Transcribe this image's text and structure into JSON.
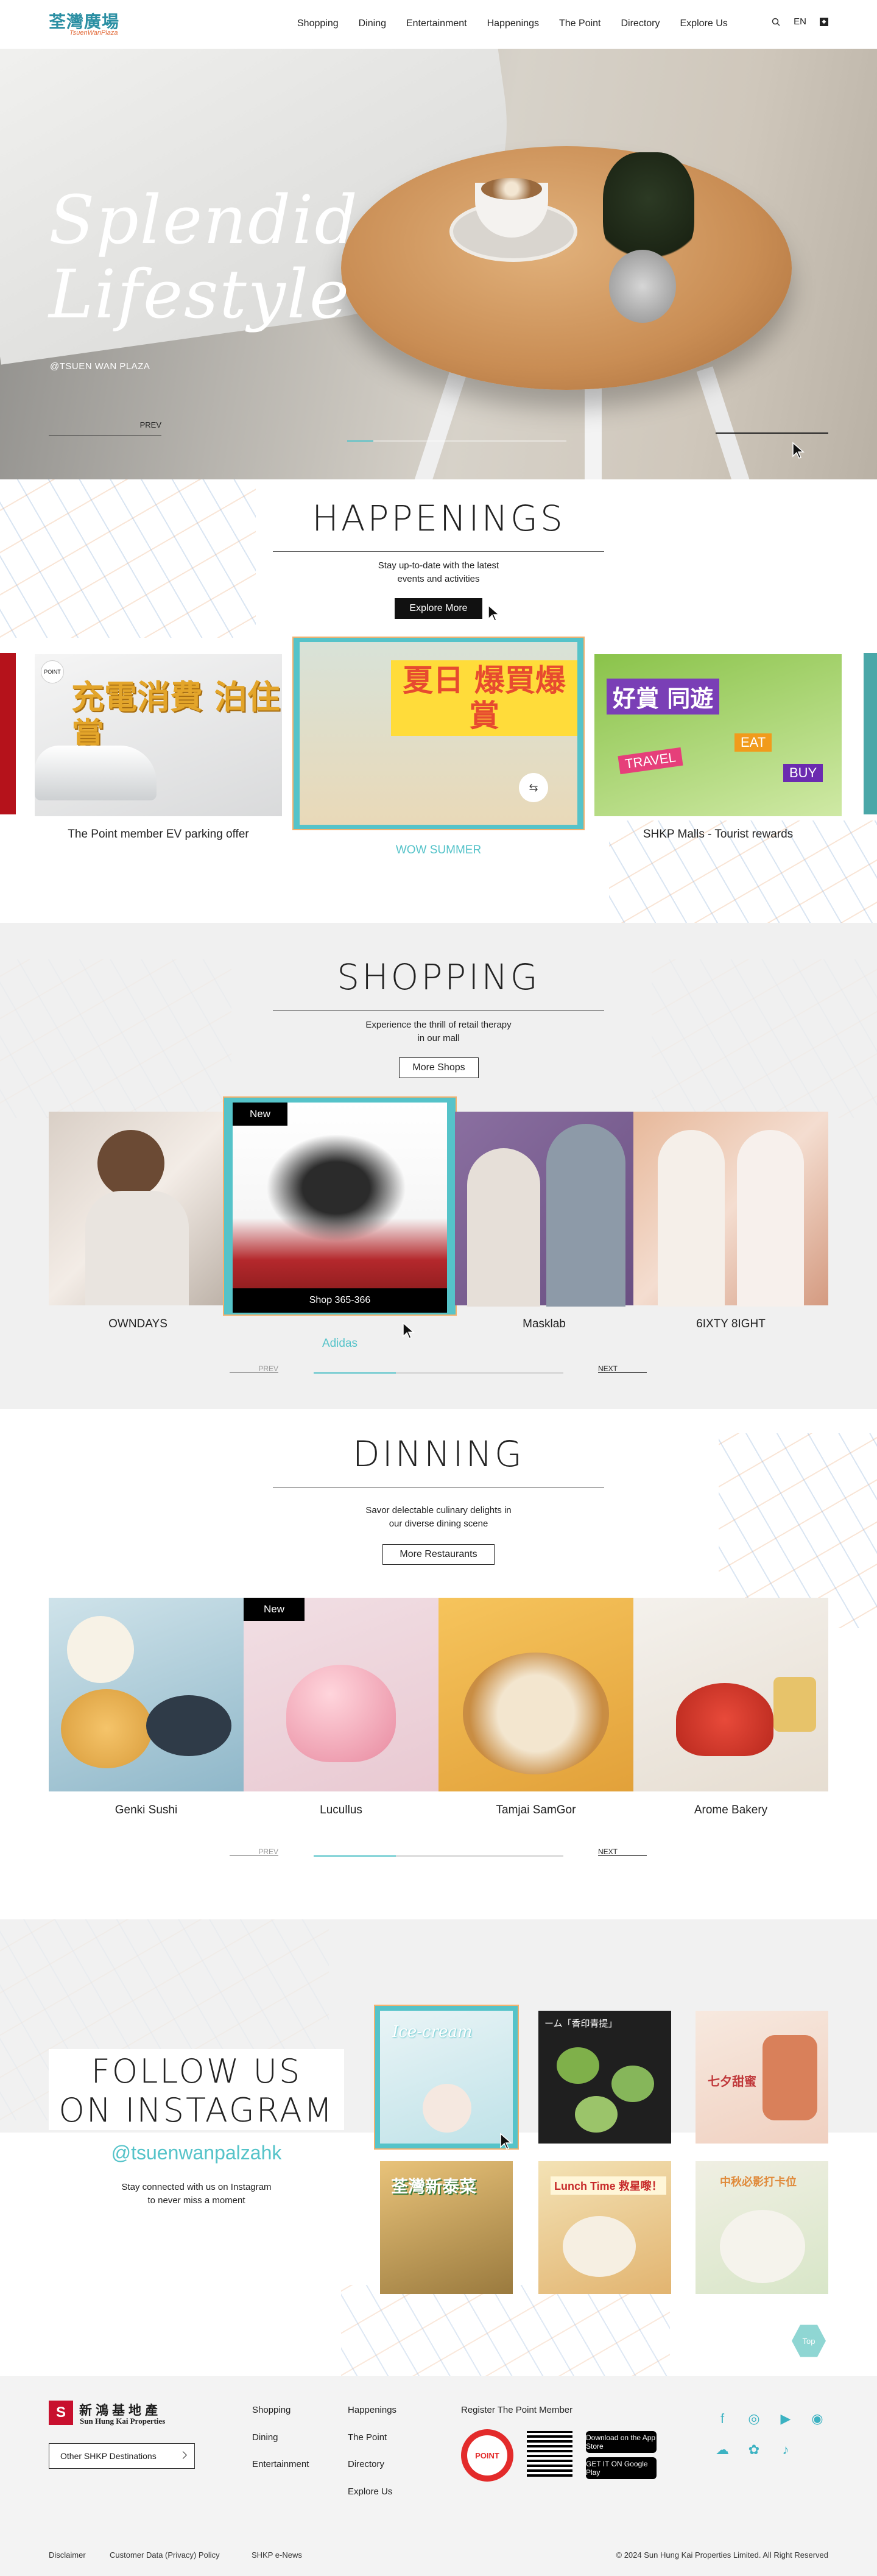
{
  "header": {
    "logo_cn": "荃灣廣場",
    "logo_en": "TsuenWanPlaza",
    "nav": [
      "Shopping",
      "Dining",
      "Entertainment",
      "Happenings",
      "The Point",
      "Directory",
      "Explore Us"
    ],
    "lang": "EN",
    "icons": [
      "search-icon",
      "user-icon"
    ]
  },
  "hero": {
    "title_line1": "Splendid",
    "title_line2": "Lifestyle",
    "subtitle": "@TSUEN WAN PLAZA",
    "prev": "PREV",
    "progress": 0.12
  },
  "happenings": {
    "title": "HAPPENINGS",
    "desc1": "Stay up-to-date with the latest",
    "desc2": "events and activities",
    "button": "Explore More",
    "cards": [
      {
        "caption": "The Point member EV parking offer",
        "art": "充電消費 泊住賞",
        "badge": "POINT"
      },
      {
        "caption": "WOW SUMMER",
        "art": "夏日 爆買爆賞"
      },
      {
        "caption": "SHKP Malls - Tourist rewards",
        "art": "好賞 同遊",
        "tag1": "TRAVEL",
        "tag2": "EAT",
        "tag3": "BUY"
      }
    ]
  },
  "shopping": {
    "title": "SHOPPING",
    "desc1": "Experience the thrill of retail therapy",
    "desc2": "in our mall",
    "button": "More Shops",
    "shops": [
      {
        "name": "OWNDAYS"
      },
      {
        "name": "Adidas",
        "badge": "New",
        "unit": "Shop 365-366"
      },
      {
        "name": "Masklab"
      },
      {
        "name": "6IXTY 8IGHT"
      }
    ],
    "prev": "PREV",
    "next": "NEXT"
  },
  "dining": {
    "title": "DINNING",
    "desc1": "Savor delectable culinary delights in",
    "desc2": "our diverse dining scene",
    "button": "More Restaurants",
    "restaurants": [
      {
        "name": "Genki Sushi"
      },
      {
        "name": "Lucullus",
        "badge": "New"
      },
      {
        "name": "Tamjai SamGor"
      },
      {
        "name": "Arome Bakery"
      }
    ],
    "prev": "PREV",
    "next": "NEXT"
  },
  "instagram": {
    "title_line1": "FOLLOW US",
    "title_line2": "ON INSTAGRAM",
    "handle": "@tsuenwanpalzahk",
    "desc1": "Stay connected with us on Instagram",
    "desc2": "to never miss a moment",
    "posts": [
      {
        "text": "Ice-cream"
      },
      {
        "text": "ーム「香印青提」"
      },
      {
        "text": "七夕甜蜜"
      },
      {
        "text": "荃灣新泰菜"
      },
      {
        "text": "Lunch Time 救星嚟！"
      },
      {
        "text": "中秋必影打卡位"
      }
    ],
    "top_label": "Top"
  },
  "footer": {
    "logo_cn": "新鴻基地產",
    "logo_en": "Sun Hung Kai Properties",
    "other_destinations": "Other SHKP Destinations",
    "col1": [
      "Shopping",
      "Dining",
      "Entertainment"
    ],
    "col2": [
      "Happenings",
      "The Point",
      "Directory",
      "Explore Us"
    ],
    "register": "Register The Point Member",
    "point_logo": "POINT",
    "app_store": "Download on the App Store",
    "google_play": "GET IT ON Google Play",
    "social_icons": [
      "facebook-icon",
      "instagram-icon",
      "youtube-icon",
      "weibo-icon",
      "wechat-icon",
      "xiaohongshu-icon",
      "douyin-icon"
    ],
    "bottom_links": [
      "Disclaimer",
      "Customer Data (Privacy) Policy",
      "SHKP e-News"
    ],
    "copyright": "© 2024 Sun Hung Kai Properties Limited. All Right Reserved"
  },
  "colors": {
    "accent": "#55c3c9",
    "orange": "#f3b16e",
    "red": "#c8102e"
  }
}
